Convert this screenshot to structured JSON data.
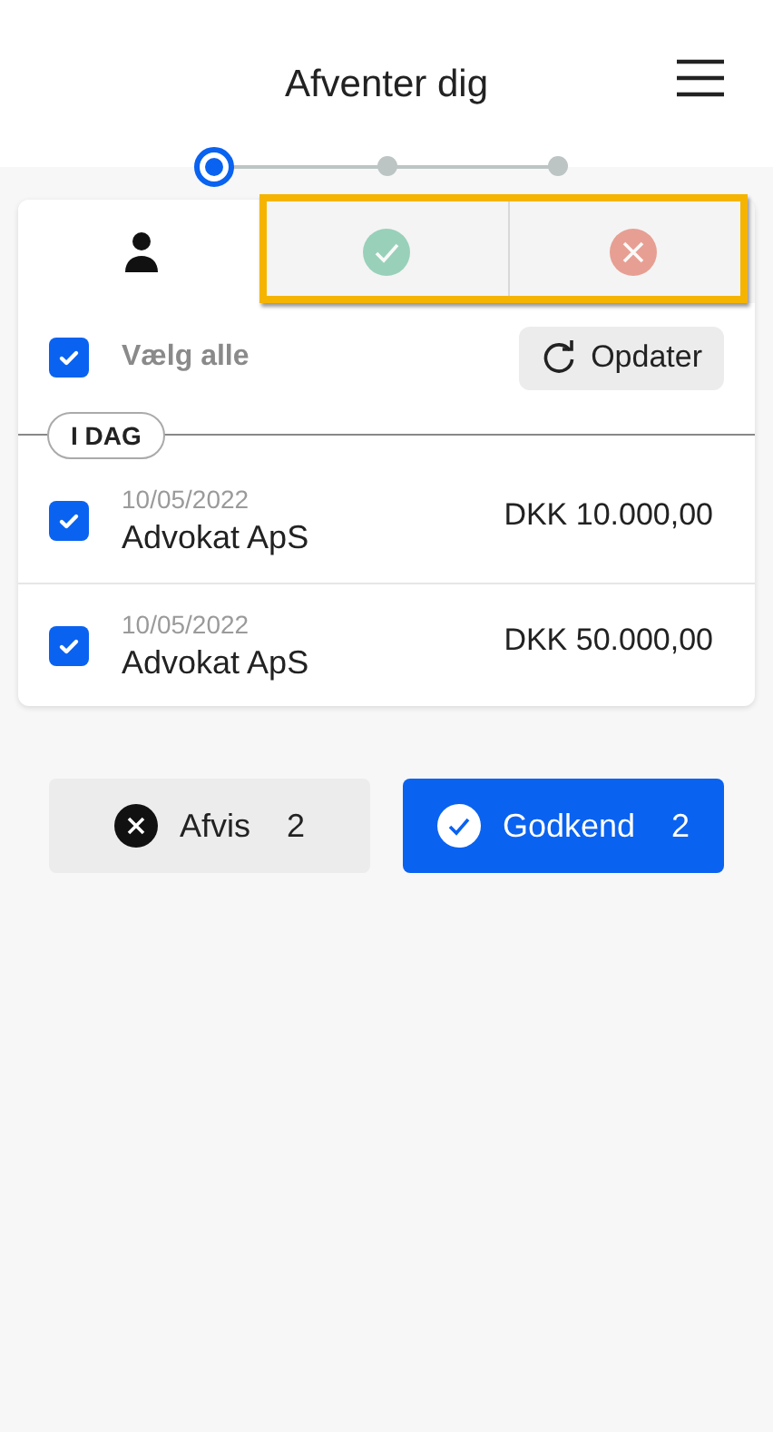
{
  "header": {
    "title": "Afventer dig"
  },
  "steps": [
    {
      "selected": true
    },
    {
      "selected": false
    },
    {
      "selected": false
    }
  ],
  "tabs": [
    {
      "kind": "person",
      "selected": true
    },
    {
      "kind": "approved",
      "selected": false
    },
    {
      "kind": "rejected",
      "selected": false
    }
  ],
  "select_all": {
    "label": "Vælg alle",
    "checked": true
  },
  "refresh_button": {
    "label": "Opdater"
  },
  "group_label": "I DAG",
  "rows": [
    {
      "date": "10/05/2022",
      "name": "Advokat ApS",
      "amount": "DKK 10.000,00",
      "checked": true
    },
    {
      "date": "10/05/2022",
      "name": "Advokat ApS",
      "amount": "DKK 50.000,00",
      "checked": true
    }
  ],
  "actions": [
    {
      "kind": "reject",
      "label": "Afvis",
      "count": "2"
    },
    {
      "kind": "approve",
      "label": "Godkend",
      "count": "2"
    }
  ]
}
